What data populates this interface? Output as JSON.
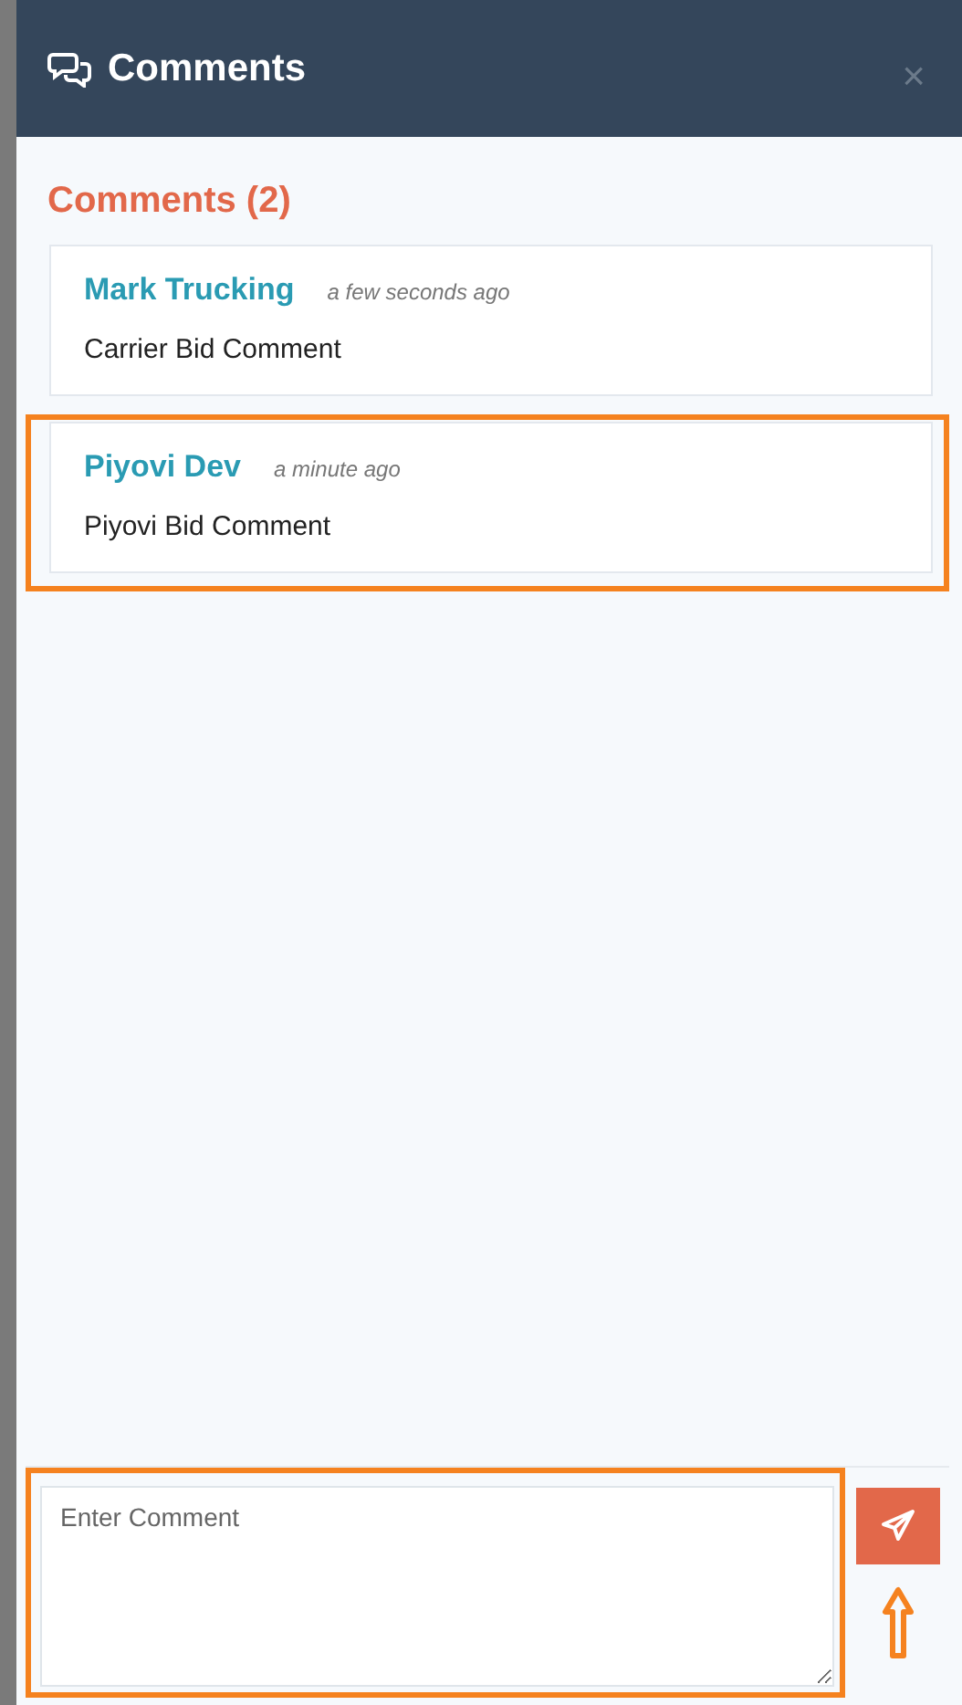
{
  "panel": {
    "title": "Comments",
    "close": "×"
  },
  "heading": "Comments (2)",
  "comments": [
    {
      "author": "Mark Trucking",
      "time": "a few seconds ago",
      "text": "Carrier Bid Comment",
      "highlighted": false
    },
    {
      "author": "Piyovi Dev",
      "time": "a minute ago",
      "text": "Piyovi Bid Comment",
      "highlighted": true
    }
  ],
  "composer": {
    "placeholder": "Enter Comment",
    "highlighted": true,
    "send_pointer": true
  }
}
